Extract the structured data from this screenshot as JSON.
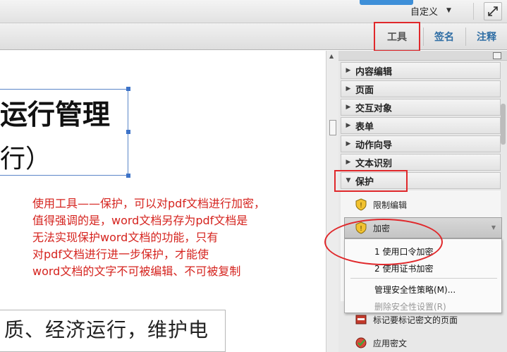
{
  "topbar": {
    "custom_label": "自定义"
  },
  "toolbar": {
    "tools_label": "工具",
    "sign_label": "签名",
    "comment_label": "注释"
  },
  "document": {
    "title_line1": "运行管理",
    "title_line2": "行）",
    "annotation_lines": [
      "使用工具——保护，可以对pdf文档进行加密，",
      "值得强调的是，word文档另存为pdf文档是",
      "无法实现保护word文档的功能，只有",
      "对pdf文档进行进一步保护，才能使",
      "word文档的文字不可被编辑、不可被复制"
    ],
    "body_line": "质、经济运行，维护电"
  },
  "panel": {
    "sections": [
      "内容编辑",
      "页面",
      "交互对象",
      "表单",
      "动作向导",
      "文本识别",
      "保护"
    ],
    "protect_items": {
      "restrict_edit": "限制编辑",
      "encrypt": "加密",
      "mark_redaction": "标记要标记密文的页面",
      "apply_redaction": "应用密文"
    },
    "encrypt_menu": {
      "password": "1 使用口令加密",
      "certificate": "2 使用证书加密",
      "manage_policy": "管理安全性策略(M)...",
      "remove_security": "删除安全性设置(R)"
    }
  },
  "colors": {
    "accent_blue": "#2e6da4",
    "highlight_red": "#e0282b",
    "annotation_red": "#d5231e"
  }
}
